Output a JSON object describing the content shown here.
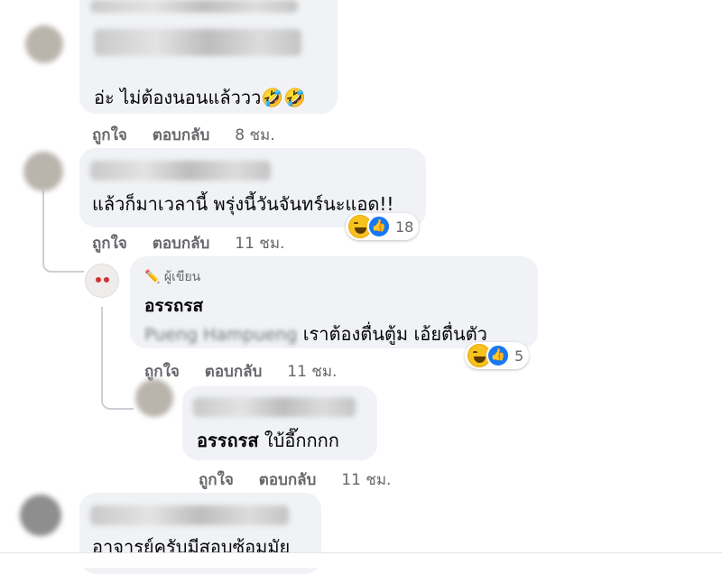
{
  "comments": [
    {
      "text": "อ่ะ ไม่ต้องนอนแล้ววว🤣🤣"
    },
    {
      "like_label": "ถูกใจ",
      "reply_label": "ตอบกลับ",
      "time": "8 ชม."
    },
    {
      "text": "แล้วก็มาเวลานี้ พรุ่งนี้วันจันทร์นะแอด!!",
      "like_label": "ถูกใจ",
      "reply_label": "ตอบกลับ",
      "time": "11 ชม.",
      "reaction_count": "18"
    },
    {
      "author_badge": "ผู้เขียน",
      "author": "อรรถรส",
      "mention_blurred": "Pueng Hampueng",
      "text": " เราต้องตื่นตู้ม เอ้ยตื่นตัว",
      "like_label": "ถูกใจ",
      "reply_label": "ตอบกลับ",
      "time": "11 ชม.",
      "reaction_count": "5"
    },
    {
      "mention": "อรรถรส",
      "text": " ใบ้อี๊กกกก",
      "like_label": "ถูกใจ",
      "reply_label": "ตอบกลับ",
      "time": "11 ชม."
    },
    {
      "text": "อาจารย์ครับมีสอบซ้อมมัย"
    }
  ],
  "icons": {
    "haha": "haha-reaction-icon",
    "like": "like-reaction-icon",
    "author": "pencil-icon"
  }
}
